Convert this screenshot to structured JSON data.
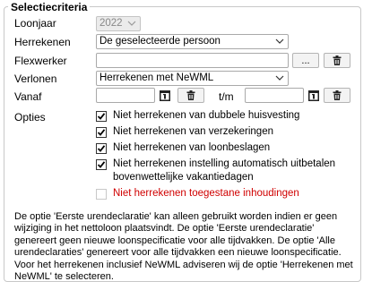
{
  "section": {
    "legend": "Selectiecriteria"
  },
  "loonjaar": {
    "label": "Loonjaar",
    "value": "2022"
  },
  "herrekenen": {
    "label": "Herrekenen",
    "value": "De geselecteerde persoon"
  },
  "flexwerker": {
    "label": "Flexwerker",
    "value": "",
    "browse_label": "..."
  },
  "verlonen": {
    "label": "Verlonen",
    "value": "Herrekenen met NeWML"
  },
  "vanaf": {
    "label": "Vanaf",
    "value": "",
    "tm_label": "t/m",
    "tm_value": ""
  },
  "opties": {
    "label": "Opties",
    "items": [
      {
        "label": "Niet herrekenen van dubbele huisvesting",
        "checked": true
      },
      {
        "label": "Niet herrekenen van verzekeringen",
        "checked": true
      },
      {
        "label": "Niet herrekenen van loonbeslagen",
        "checked": true
      },
      {
        "label": "Niet herrekenen instelling automatisch uitbetalen",
        "label2": "bovenwettelijke vakantiedagen",
        "checked": true
      },
      {
        "label": "Niet herrekenen toegestane inhoudingen",
        "checked": false
      }
    ]
  },
  "info_text": "De optie 'Eerste urendeclaratie' kan alleen gebruikt worden indien er geen wijziging in het nettoloon plaatsvindt. De optie 'Eerste urendeclaratie' genereert geen nieuwe loonspecificatie voor alle tijdvakken. De optie 'Alle urendeclaraties' genereert voor alle tijdvakken een nieuwe loonspecificatie. Voor het herrekenen inclusief NeWML adviseren wij de optie 'Herrekenen met NeWML' te selecteren.",
  "colors": {
    "warning_text": "#d00000",
    "disabled_bg": "#ebebeb"
  }
}
